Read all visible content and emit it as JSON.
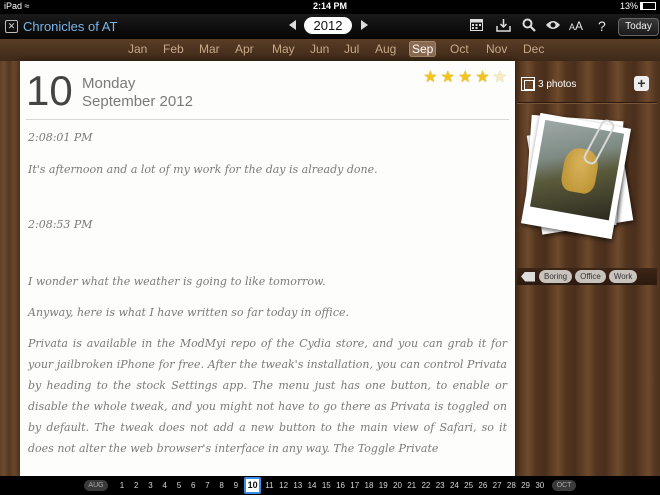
{
  "status_bar": {
    "device": "iPad",
    "time": "2:14 PM",
    "battery": "13%"
  },
  "toolbar": {
    "app_title": "Chronicles of AT",
    "year": "2012",
    "icons": [
      "calendar-icon",
      "export-icon",
      "search-icon",
      "eye-icon",
      "font-size-icon",
      "help-icon"
    ],
    "font_size_label": "AA",
    "help_label": "?",
    "today_label": "Today"
  },
  "months": [
    "Jan",
    "Feb",
    "Mar",
    "Apr",
    "May",
    "Jun",
    "Jul",
    "Aug",
    "Sep",
    "Oct",
    "Nov",
    "Dec"
  ],
  "selected_month": "Sep",
  "entry_header": {
    "day": "10",
    "weekday": "Monday",
    "month_year": "September 2012",
    "rating": 4,
    "rating_max": 5
  },
  "entries": [
    {
      "kind": "time",
      "text": "2:08:01 PM"
    },
    {
      "kind": "body",
      "text": "It's afternoon and a lot of my work for the day is already done."
    },
    {
      "kind": "time",
      "text": "2:08:53 PM"
    },
    {
      "kind": "body",
      "text": "I wonder what the weather is going to like tomorrow."
    },
    {
      "kind": "body",
      "text": "Anyway, here is what I have written so far today in office."
    },
    {
      "kind": "body",
      "text": "Privata is available in the ModMyi repo of the Cydia store, and you can grab it for your jailbroken iPhone for free. After the tweak's installation, you can control Privata by heading to the stock Settings app. The menu just has one button, to enable or disable the whole tweak, and you might not have to go there as Privata is toggled on by default. The tweak does not add a new button to the main view of Safari, so it does not alter the web browser's interface in any way. The Toggle Private"
    }
  ],
  "photos": {
    "count_label": "3 photos",
    "add_label": "+"
  },
  "tags": [
    "Boring",
    "Office",
    "Work"
  ],
  "day_bar": {
    "prev_month": "AUG",
    "next_month": "OCT",
    "days": [
      "1",
      "2",
      "3",
      "4",
      "5",
      "6",
      "7",
      "8",
      "9",
      "10",
      "11",
      "12",
      "13",
      "14",
      "15",
      "16",
      "17",
      "18",
      "19",
      "20",
      "21",
      "22",
      "23",
      "24",
      "25",
      "26",
      "27",
      "28",
      "29",
      "30"
    ],
    "selected_day": "10"
  }
}
